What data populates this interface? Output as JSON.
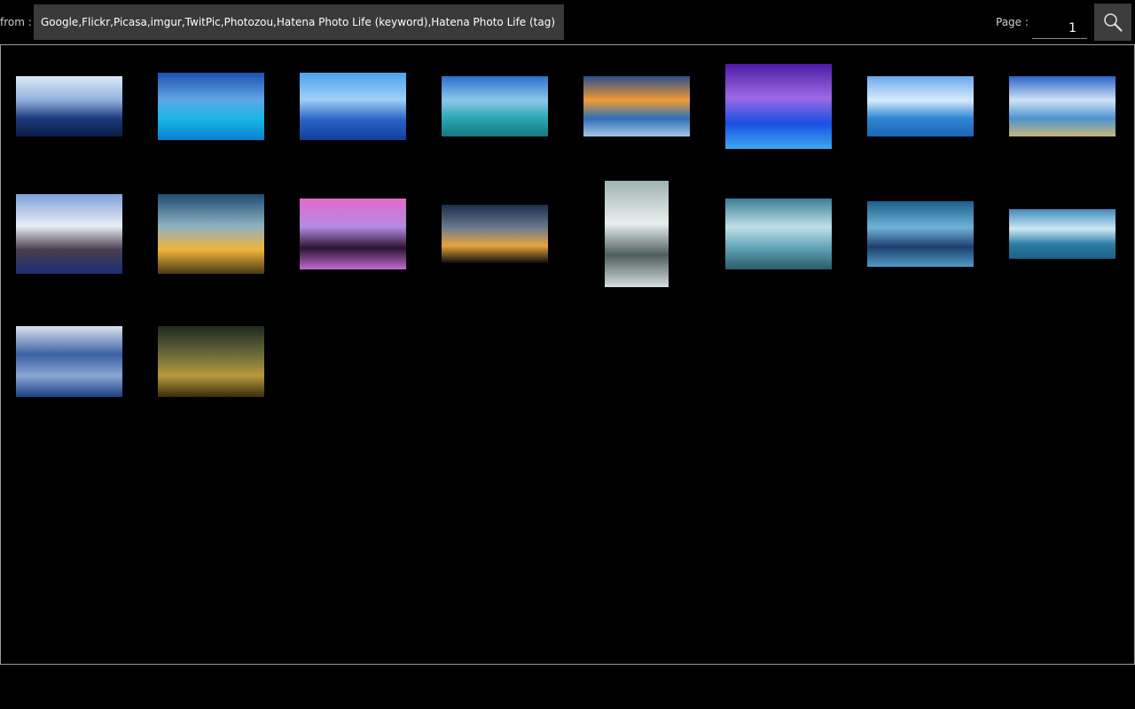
{
  "search": {
    "from_label": "from :",
    "sources_value": "Google,Flickr,Picasa,imgur,TwitPic,Photozou,Hatena Photo Life (keyword),Hatena Photo Life (tag)",
    "page_label": "Page :",
    "page_value": "1",
    "search_icon": "magnifier-icon"
  },
  "thumbnails": [
    {
      "name": "thumb-1",
      "colors": [
        "#dfe9f7",
        "#8fb1de",
        "#1d3a7d",
        "#0b1d46"
      ]
    },
    {
      "name": "thumb-2",
      "colors": [
        "#1f4fb0",
        "#5ea7e6",
        "#17b5e6",
        "#0b7fd0"
      ]
    },
    {
      "name": "thumb-3",
      "colors": [
        "#4aa2ee",
        "#9fd0f6",
        "#2a63c6",
        "#133f9a"
      ]
    },
    {
      "name": "thumb-4",
      "colors": [
        "#2c6fcc",
        "#8cc7ec",
        "#2aa7b2",
        "#16787e"
      ]
    },
    {
      "name": "thumb-5",
      "colors": [
        "#2a4f8b",
        "#f09a34",
        "#2d6fb6",
        "#a6c6e3"
      ]
    },
    {
      "name": "thumb-6",
      "colors": [
        "#4d1aa6",
        "#9c6ae6",
        "#1b4fe2",
        "#3ba9f0"
      ]
    },
    {
      "name": "thumb-7",
      "colors": [
        "#6aa9ea",
        "#d6ebfb",
        "#2f86d4",
        "#1a64b5"
      ]
    },
    {
      "name": "thumb-8",
      "colors": [
        "#2b64c7",
        "#cfe3f6",
        "#4d93cf",
        "#c7b57c"
      ]
    },
    {
      "name": "thumb-9",
      "colors": [
        "#7fa0d8",
        "#e8eef7",
        "#4a3d4d",
        "#1b2f77"
      ]
    },
    {
      "name": "thumb-10",
      "colors": [
        "#1f4a72",
        "#8fb1c2",
        "#f0b43a",
        "#4a3a12"
      ]
    },
    {
      "name": "thumb-11",
      "colors": [
        "#e16bc9",
        "#b48ae0",
        "#2a1530",
        "#c26ad1"
      ]
    },
    {
      "name": "thumb-12",
      "colors": [
        "#1c2f4a",
        "#6b7b8f",
        "#e9a33a",
        "#0b0b0b"
      ]
    },
    {
      "name": "thumb-13",
      "colors": [
        "#9fb3b1",
        "#e9efee",
        "#4c5e5d",
        "#d6dedd"
      ]
    },
    {
      "name": "thumb-14",
      "colors": [
        "#3a7e98",
        "#bfe0e6",
        "#5fa2b5",
        "#2a5b6a"
      ]
    },
    {
      "name": "thumb-15",
      "colors": [
        "#1b5e8b",
        "#6fb4d8",
        "#1d3f6e",
        "#4f9cc6"
      ]
    },
    {
      "name": "thumb-16",
      "colors": [
        "#3f8bbf",
        "#cfe7f3",
        "#2e7ea8",
        "#1c5f86"
      ]
    },
    {
      "name": "thumb-17",
      "colors": [
        "#d9e2ef",
        "#3a5fa3",
        "#8aa7d3",
        "#1c3c83"
      ]
    },
    {
      "name": "thumb-18",
      "colors": [
        "#1f2a1f",
        "#6b6a3a",
        "#b79a3c",
        "#3a2c0f"
      ]
    }
  ]
}
